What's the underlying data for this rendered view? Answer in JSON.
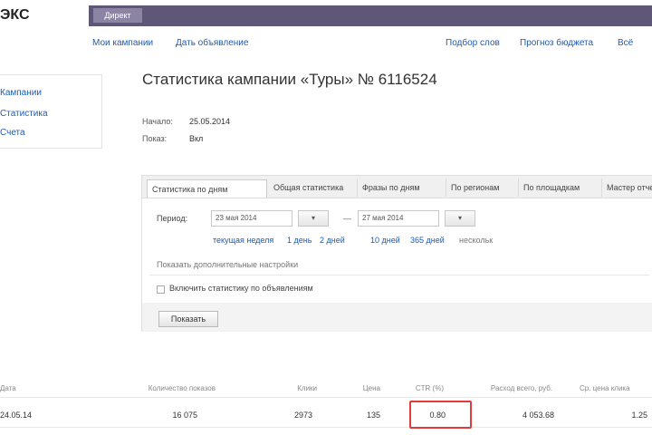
{
  "header": {
    "logo": "ЭКС",
    "tab_label": "Директ"
  },
  "nav": {
    "my_campaigns": "Мои кампании",
    "add_campaign": "Дать объявление",
    "right1": "Подбор слов",
    "right2": "Прогноз бюджета",
    "right3": "Всё"
  },
  "sidebar": {
    "items": [
      "Кампании",
      "Статистика",
      "Счета"
    ]
  },
  "page": {
    "title": "Статистика кампании «Туры» № 6116524",
    "meta": [
      {
        "key": "Начало:",
        "value": "25.05.2014"
      },
      {
        "key": "Показ:",
        "value": "Вкл"
      }
    ]
  },
  "tabs": [
    "Статистика по дням",
    "Общая статистика",
    "Фразы по дням",
    "По регионам",
    "По площадкам",
    "Мастер отчетов"
  ],
  "filter": {
    "period_label": "Период:",
    "date_from": "23 мая 2014",
    "date_to": "27 мая 2014",
    "cal_label": "▾",
    "dash": "—",
    "quick_links": [
      "текущая неделя",
      "1 день",
      "2 дней",
      "10 дней",
      "365 дней"
    ],
    "quick_suffix": "нескольк",
    "advanced": "Показать дополнительные настройки",
    "checkbox_label": "Включить статистику по объявлениям",
    "show_button": "Показать"
  },
  "table": {
    "headers": [
      "Дата",
      "Количество показов",
      "Клики",
      "Цена",
      "CTR (%)",
      "Расход всего, руб.",
      "Ср. цена клика"
    ],
    "row": [
      "24.05.14",
      "16 075",
      "2973",
      "135",
      "0.80",
      "4 053.68",
      "1.25"
    ]
  },
  "colors": {
    "topbar": "#5e5777",
    "link": "#1a5bb8",
    "highlight": "#e23b3b"
  }
}
